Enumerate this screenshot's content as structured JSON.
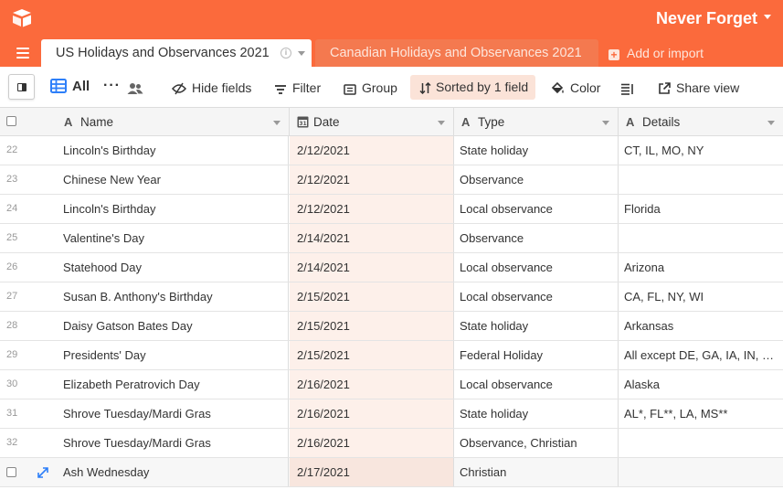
{
  "app": {
    "base_name": "Never Forget",
    "accent": "#fb6a3c",
    "logo_icon": "airtable-logo-icon"
  },
  "tabs": [
    {
      "label": "US Holidays and Observances 2021",
      "active": true
    },
    {
      "label": "Canadian Holidays and Observances 2021",
      "active": false
    }
  ],
  "add_import_label": "Add or import",
  "toolbar": {
    "view_label": "All",
    "hide_fields": "Hide fields",
    "filter": "Filter",
    "group": "Group",
    "sorted": "Sorted by 1 field",
    "color": "Color",
    "share_view": "Share view"
  },
  "columns": [
    {
      "label": "Name",
      "icon": "text-field-icon"
    },
    {
      "label": "Date",
      "icon": "date-field-icon"
    },
    {
      "label": "Type",
      "icon": "text-field-icon"
    },
    {
      "label": "Details",
      "icon": "text-field-icon"
    }
  ],
  "rows": [
    {
      "num": "22",
      "name": "Lincoln's Birthday",
      "date": "2/12/2021",
      "type": "State holiday",
      "details": "CT, IL, MO, NY"
    },
    {
      "num": "23",
      "name": "Chinese New Year",
      "date": "2/12/2021",
      "type": "Observance",
      "details": ""
    },
    {
      "num": "24",
      "name": "Lincoln's Birthday",
      "date": "2/12/2021",
      "type": "Local observance",
      "details": "Florida"
    },
    {
      "num": "25",
      "name": "Valentine's Day",
      "date": "2/14/2021",
      "type": "Observance",
      "details": ""
    },
    {
      "num": "26",
      "name": "Statehood Day",
      "date": "2/14/2021",
      "type": "Local observance",
      "details": "Arizona"
    },
    {
      "num": "27",
      "name": "Susan B. Anthony's Birthday",
      "date": "2/15/2021",
      "type": "Local observance",
      "details": "CA, FL, NY, WI"
    },
    {
      "num": "28",
      "name": "Daisy Gatson Bates Day",
      "date": "2/15/2021",
      "type": "State holiday",
      "details": "Arkansas"
    },
    {
      "num": "29",
      "name": "Presidents' Day",
      "date": "2/15/2021",
      "type": "Federal Holiday",
      "details": "All except DE, GA, IA, IN, …"
    },
    {
      "num": "30",
      "name": "Elizabeth Peratrovich Day",
      "date": "2/16/2021",
      "type": "Local observance",
      "details": "Alaska"
    },
    {
      "num": "31",
      "name": "Shrove Tuesday/Mardi Gras",
      "date": "2/16/2021",
      "type": "State holiday",
      "details": "AL*, FL**, LA, MS**"
    },
    {
      "num": "32",
      "name": "Shrove Tuesday/Mardi Gras",
      "date": "2/16/2021",
      "type": "Observance, Christian",
      "details": ""
    },
    {
      "num": "",
      "name": "Ash Wednesday",
      "date": "2/17/2021",
      "type": "Christian",
      "details": "",
      "hover": true
    }
  ]
}
